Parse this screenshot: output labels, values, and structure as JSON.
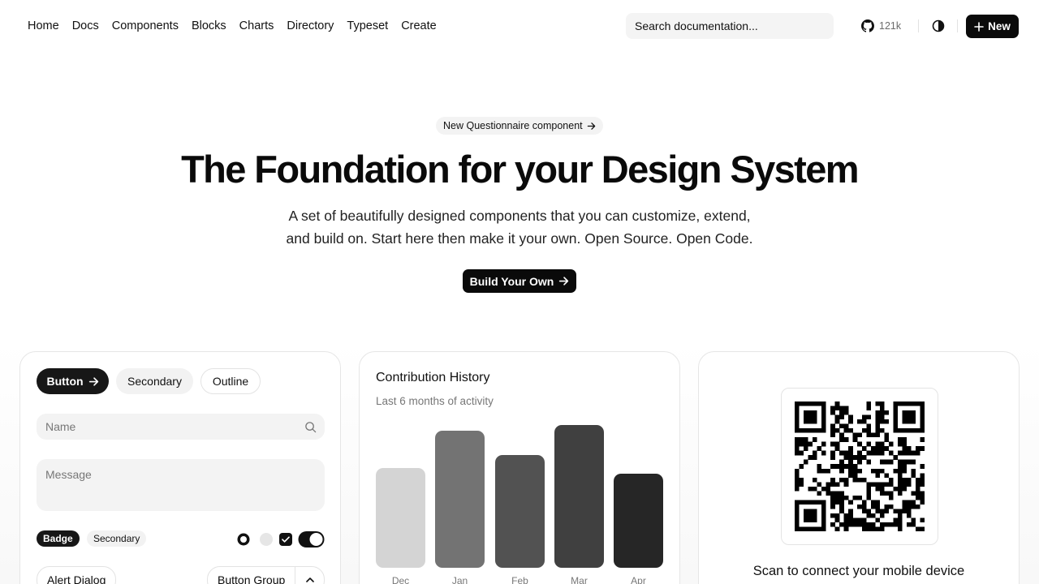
{
  "nav": {
    "items": [
      "Home",
      "Docs",
      "Components",
      "Blocks",
      "Charts",
      "Directory",
      "Typeset",
      "Create"
    ],
    "search_placeholder": "Search documentation...",
    "github_stars": "121k",
    "new_label": "New"
  },
  "hero": {
    "announcement": "New Questionnaire component",
    "title": "The Foundation for your Design System",
    "subtitle_line1": "A set of beautifully designed components that you can customize, extend,",
    "subtitle_line2": "and build on. Start here then make it your own. Open Source. Open Code.",
    "cta_label": "Build Your Own"
  },
  "components_card": {
    "button_label": "Button",
    "secondary_label": "Secondary",
    "outline_label": "Outline",
    "name_placeholder": "Name",
    "message_placeholder": "Message",
    "badge_label": "Badge",
    "badge_secondary_label": "Secondary",
    "alert_dialog_label": "Alert Dialog",
    "button_group_label": "Button Group"
  },
  "chart_card": {
    "title": "Contribution History",
    "description": "Last 6 months of activity"
  },
  "chart_data": {
    "type": "bar",
    "categories": [
      "Dec",
      "Jan",
      "Feb",
      "Mar",
      "Apr"
    ],
    "values": [
      123,
      169,
      139,
      176,
      116
    ],
    "colors": [
      "#d4d4d4",
      "#737373",
      "#525252",
      "#404040",
      "#262626"
    ],
    "title": "Contribution History",
    "subtitle": "Last 6 months of activity",
    "grid": false
  },
  "qr_card": {
    "caption": "Scan to connect your mobile device"
  }
}
